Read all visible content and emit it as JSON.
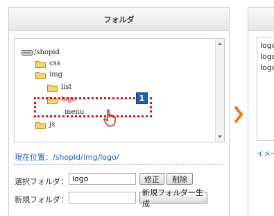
{
  "left_panel": {
    "title": "フォルダ",
    "tree": [
      {
        "label": "/shopid",
        "icon": "drive-icon"
      },
      {
        "label": "css",
        "icon": "folder-icon"
      },
      {
        "label": "img",
        "icon": "folder-icon"
      },
      {
        "label": "list",
        "icon": "folder-icon"
      },
      {
        "label": "logo",
        "icon": "folder-icon",
        "selected": true
      },
      {
        "label": "menu",
        "icon": "folder-icon"
      },
      {
        "label": "js",
        "icon": "folder-icon"
      }
    ],
    "callout_badge": "1",
    "current_location": "現在位置：/shopid/img/logo/",
    "form": {
      "selected_folder_label": "選択フォルダ：",
      "selected_folder_value": "logo",
      "edit_button": "修正",
      "delete_button": "削除",
      "new_folder_label": "新規フォルダ：",
      "new_folder_value": "",
      "create_button": "新規フォルダー生成"
    }
  },
  "right_panel": {
    "preview_lines": [
      "logo",
      "logo",
      "logo"
    ],
    "image_link": "イメー"
  },
  "colors": {
    "selection_outline": "#e01010",
    "badge": "#1a64b8",
    "link": "#2060b0",
    "arrow": "#f07a1a"
  }
}
